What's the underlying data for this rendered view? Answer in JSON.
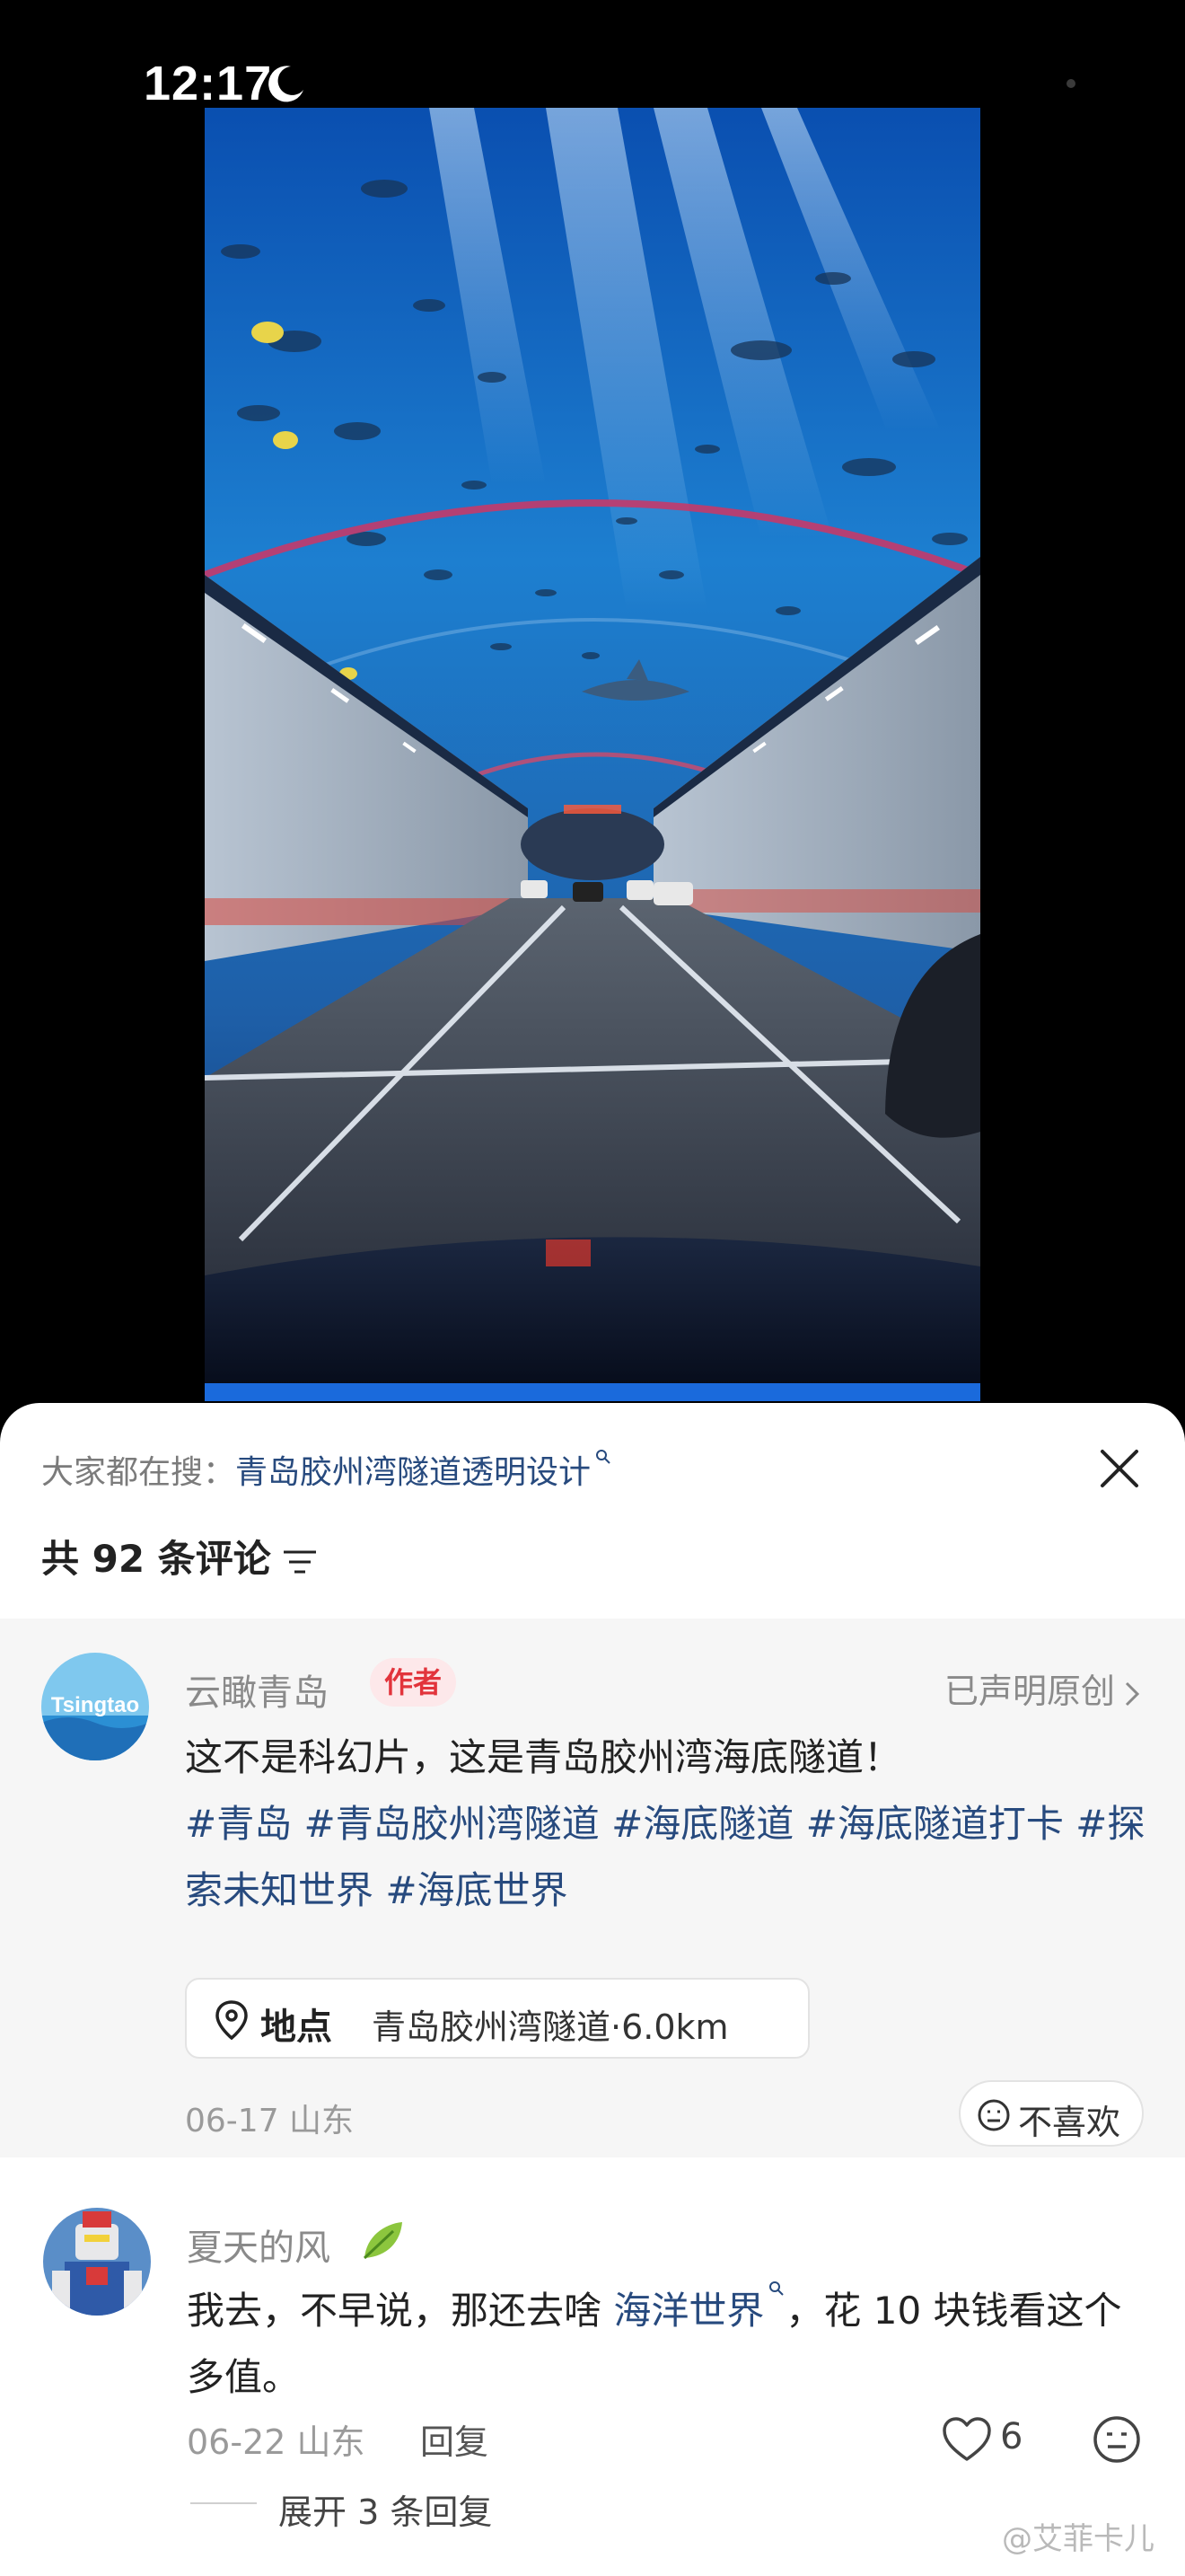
{
  "status_bar": {
    "time": "12:17"
  },
  "search_hint": {
    "prefix": "大家都在搜：",
    "term": "青岛胶州湾隧道透明设计"
  },
  "comments_header": {
    "count_label": "共 92 条评论"
  },
  "author_comment": {
    "username": "云瞰青岛",
    "author_tag": "作者",
    "original_claim": "已声明原创",
    "text": "这不是科幻片，这是青岛胶州湾海底隧道！",
    "hashtags": "#青岛 #青岛胶州湾隧道 #海底隧道 #海底隧道打卡 #探索未知世界 #海底世界",
    "avatar_text": "Tsingtao",
    "location_label": "地点",
    "location_value": "青岛胶州湾隧道·6.0km",
    "meta": "06-17 山东",
    "dislike_label": "不喜欢"
  },
  "reply_comment": {
    "username": "夏天的风",
    "text_before": "我去，不早说，那还去啥 ",
    "link_text": "海洋世界",
    "text_after": "，花 10 块钱看这个多值。",
    "meta": "06-22 山东",
    "reply_label": "回复",
    "like_count": "6",
    "expand_label": "展开 3 条回复"
  },
  "watermark": "@艾菲卡儿",
  "icons": {
    "moon": "moon-icon",
    "close": "close-icon",
    "sort": "sort-icon",
    "chevron": "chevron-right-icon",
    "location": "location-pin-icon",
    "dislike": "neutral-face-icon",
    "leaf": "leaf-icon",
    "like": "heart-icon",
    "emoji": "emoji-icon"
  },
  "colors": {
    "link": "#274a7e",
    "author_tag_bg": "#fde8ea",
    "author_tag_text": "#e2343c",
    "sheet_bg": "#ffffff",
    "author_block_bg": "#f6f6f6"
  }
}
